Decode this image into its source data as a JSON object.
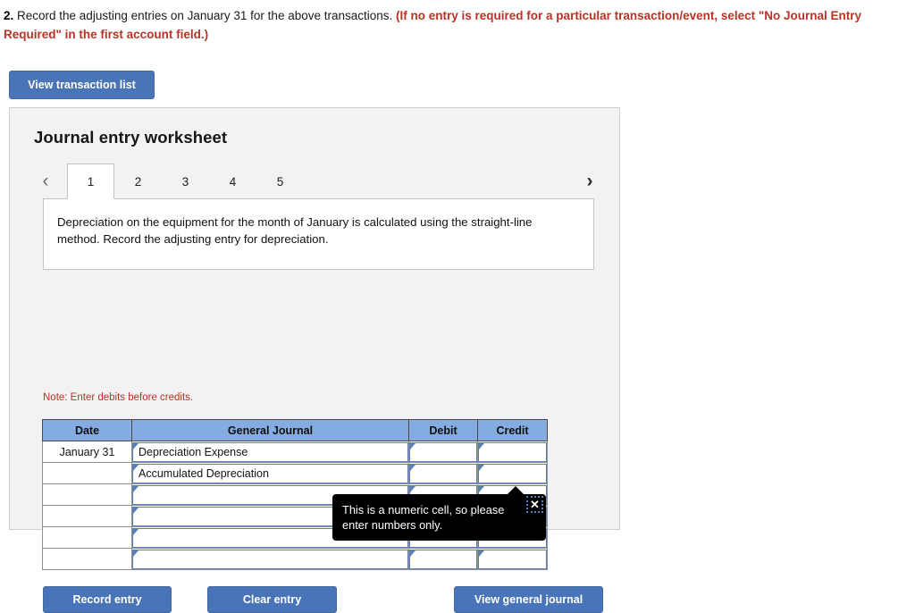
{
  "prompt": {
    "number": "2.",
    "black_text": " Record the adjusting entries on January 31 for the above transactions. ",
    "red_text": "(If no entry is required for a particular transaction/event, select \"No Journal Entry Required\" in the first account field.)"
  },
  "buttons": {
    "view_transaction_list": "View transaction list",
    "record_entry": "Record entry",
    "clear_entry": "Clear entry",
    "view_general_journal": "View general journal"
  },
  "worksheet": {
    "title": "Journal entry worksheet",
    "prev_arrow": "‹",
    "next_arrow": "›",
    "tabs": [
      {
        "label": "1",
        "active": true
      },
      {
        "label": "2",
        "active": false
      },
      {
        "label": "3",
        "active": false
      },
      {
        "label": "4",
        "active": false
      },
      {
        "label": "5",
        "active": false
      }
    ],
    "description": "Depreciation on the equipment for the month of January is calculated using the straight-line method. Record the adjusting entry for depreciation.",
    "note": "Note: Enter debits before credits."
  },
  "journal": {
    "headers": [
      "Date",
      "General Journal",
      "Debit",
      "Credit"
    ],
    "rows": [
      {
        "date": "January 31",
        "account": "Depreciation Expense",
        "debit": "",
        "credit": ""
      },
      {
        "date": "",
        "account": "Accumulated Depreciation",
        "debit": "",
        "credit": ""
      },
      {
        "date": "",
        "account": "",
        "debit": "",
        "credit": ""
      },
      {
        "date": "",
        "account": "",
        "debit": "",
        "credit": ""
      },
      {
        "date": "",
        "account": "",
        "debit": "",
        "credit": ""
      },
      {
        "date": "",
        "account": "",
        "debit": "",
        "credit": ""
      }
    ]
  },
  "tooltip": {
    "message": "This is a numeric cell, so please enter numbers only.",
    "close_label": "✕"
  },
  "colors": {
    "button_blue": "#4a74b8",
    "header_blue": "#85ace0",
    "alert_red": "#b93226",
    "panel_gray": "#f2f2f2"
  }
}
